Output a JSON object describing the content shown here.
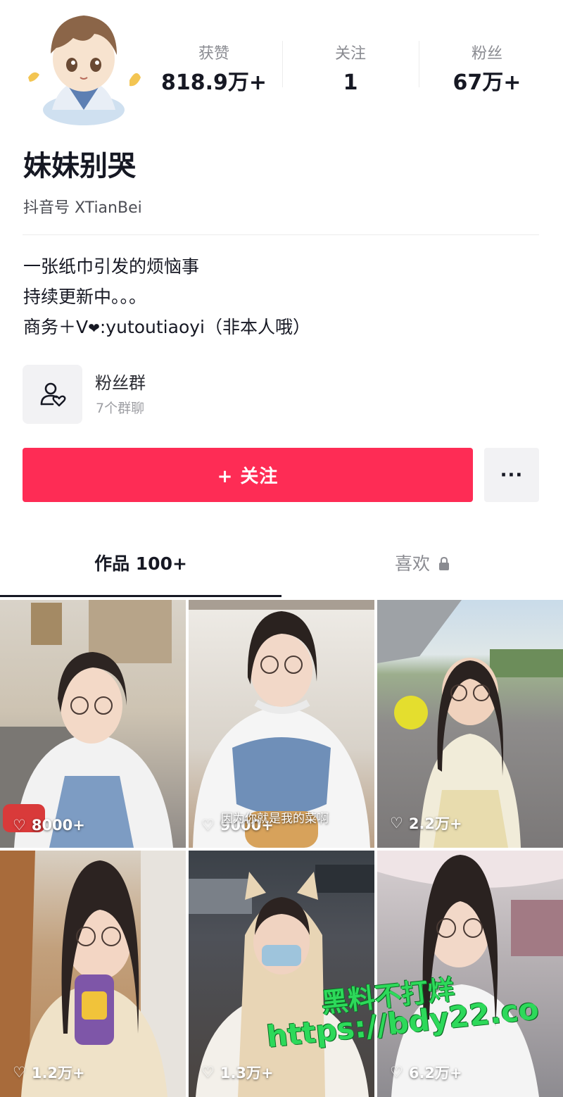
{
  "profile": {
    "name": "妹妹别哭",
    "douyin_id": "抖音号 XTianBei",
    "bio_lines": [
      "一张纸巾引发的烦恼事",
      "持续更新中。。。"
    ],
    "bio_contact_prefix": "商务＋V",
    "bio_contact_suffix": ":yutoutiaoyi（非本人哦）"
  },
  "stats": [
    {
      "label": "获赞",
      "value": "818.9万+"
    },
    {
      "label": "关注",
      "value": "1"
    },
    {
      "label": "粉丝",
      "value": "67万+"
    }
  ],
  "fans_group": {
    "title": "粉丝群",
    "subtitle": "7个群聊",
    "icon": "group-heart-icon"
  },
  "actions": {
    "follow_label": "+ 关注",
    "more_label": "···"
  },
  "tabs": {
    "works": "作品 100+",
    "likes": "喜欢"
  },
  "videos": [
    {
      "likes": "8000+"
    },
    {
      "likes": "9000+",
      "caption": "因为你就是我的菜啊"
    },
    {
      "likes": "2.2万+"
    },
    {
      "likes": "1.2万+"
    },
    {
      "likes": "1.3万+"
    },
    {
      "likes": "6.2万+"
    }
  ],
  "watermark": {
    "line1": "黑料不打烊",
    "line2": "https://bdy22.co"
  },
  "colors": {
    "accent": "#fe2c55",
    "text": "#161823",
    "muted": "#8a8b91"
  }
}
